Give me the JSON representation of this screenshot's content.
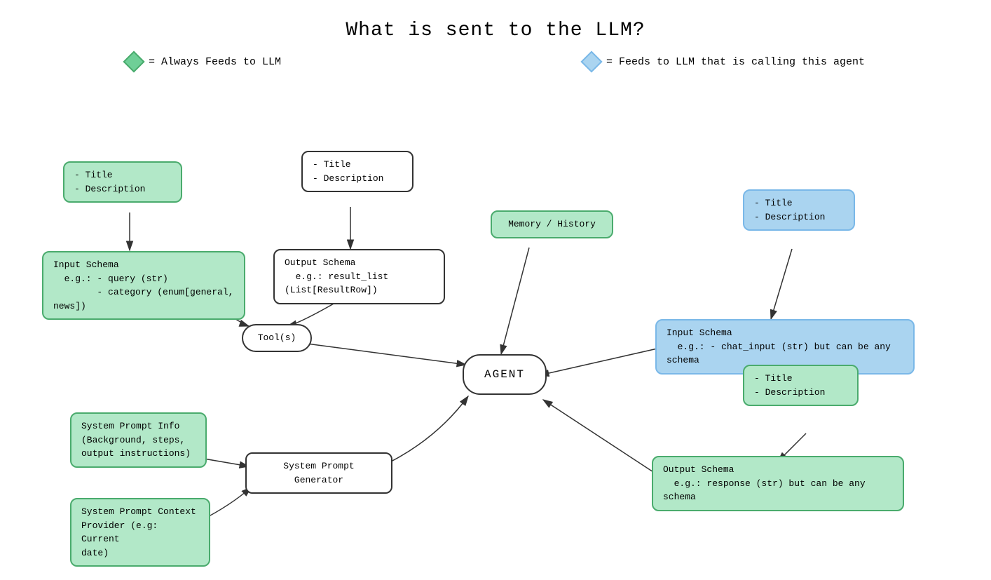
{
  "title": "What is sent to the LLM?",
  "legend": {
    "green_label": "= Always Feeds to LLM",
    "blue_label": "= Feeds to LLM that is calling this agent"
  },
  "nodes": {
    "tool_title_left": "- Title\n- Description",
    "input_schema": "Input Schema\n  e.g.: - query (str)\n        - category (enum[general, news])",
    "tool_title_middle": "- Title\n- Description",
    "output_schema_tool": "Output Schema\n  e.g.: result_list (List[ResultRow])",
    "tools": "Tool(s)",
    "memory": "Memory / History",
    "agent": "AGENT",
    "system_prompt_info": "System Prompt Info\n(Background, steps,\noutput instructions)",
    "system_prompt_generator": "System Prompt Generator",
    "system_prompt_context": "System Prompt Context\nProvider (e.g: Current\ndate)",
    "title_desc_blue": "- Title\n- Description",
    "input_schema_blue": "Input Schema\n  e.g.: - chat_input (str) but can be any schema",
    "title_desc_green_right": "- Title\n- Description",
    "output_schema_right": "Output Schema\n  e.g.: response (str) but can be any schema"
  }
}
